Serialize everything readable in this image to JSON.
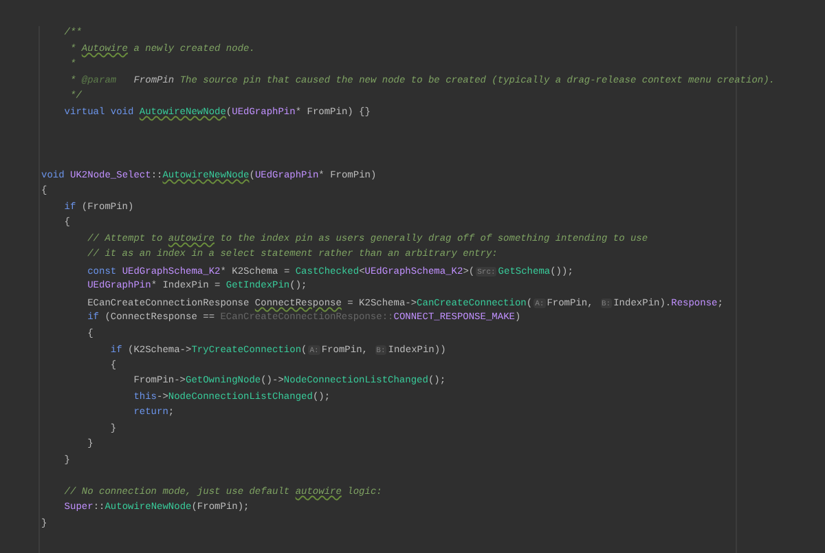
{
  "editor": {
    "lines": [
      {
        "kind": "code",
        "tokens": [
          {
            "text": "    /**",
            "kind": "comment"
          }
        ]
      },
      {
        "kind": "code",
        "tokens": [
          {
            "text": "     * ",
            "kind": "comment"
          },
          {
            "text": "Autowire",
            "kind": "comment",
            "wavy": true
          },
          {
            "text": " a newly created node.",
            "kind": "comment"
          }
        ]
      },
      {
        "kind": "code",
        "tokens": [
          {
            "text": "     *",
            "kind": "comment"
          }
        ]
      },
      {
        "kind": "code",
        "tokens": [
          {
            "text": "     * ",
            "kind": "comment"
          },
          {
            "text": "@param",
            "kind": "doctag"
          },
          {
            "text": "   FromPin",
            "kind": "docparam"
          },
          {
            "text": " The source pin that caused the new node to be created (typically a drag-release context menu creation).",
            "kind": "comment"
          }
        ]
      },
      {
        "kind": "code",
        "tokens": [
          {
            "text": "     */",
            "kind": "comment"
          }
        ]
      },
      {
        "kind": "code",
        "tokens": [
          {
            "text": "    virtual void ",
            "kind": "keyword"
          },
          {
            "text": "AutowireNewNode",
            "kind": "func",
            "wavy": true
          },
          {
            "text": "(",
            "kind": "plain"
          },
          {
            "text": "UEdGraphPin",
            "kind": "type"
          },
          {
            "text": "* FromPin) {}",
            "kind": "plain"
          }
        ]
      },
      {
        "kind": "blank"
      },
      {
        "kind": "blank"
      },
      {
        "kind": "blank"
      },
      {
        "kind": "code",
        "tokens": [
          {
            "text": "void ",
            "kind": "keyword"
          },
          {
            "text": "UK2Node_Select",
            "kind": "type"
          },
          {
            "text": "::",
            "kind": "plain"
          },
          {
            "text": "AutowireNewNode",
            "kind": "func",
            "wavy": true
          },
          {
            "text": "(",
            "kind": "plain"
          },
          {
            "text": "UEdGraphPin",
            "kind": "type"
          },
          {
            "text": "* FromPin)",
            "kind": "plain"
          }
        ]
      },
      {
        "kind": "code",
        "tokens": [
          {
            "text": "{",
            "kind": "plain"
          }
        ]
      },
      {
        "kind": "code",
        "tokens": [
          {
            "text": "    if",
            "kind": "keyword"
          },
          {
            "text": " (FromPin)",
            "kind": "plain"
          }
        ]
      },
      {
        "kind": "code",
        "tokens": [
          {
            "text": "    {",
            "kind": "plain"
          }
        ]
      },
      {
        "kind": "code",
        "tokens": [
          {
            "text": "        // Attempt to ",
            "kind": "comment"
          },
          {
            "text": "autowire",
            "kind": "comment",
            "wavy": true
          },
          {
            "text": " to the index pin as users generally drag off of something intending to use",
            "kind": "comment"
          }
        ]
      },
      {
        "kind": "code",
        "tokens": [
          {
            "text": "        // it as an index in a select statement rather than an arbitrary entry:",
            "kind": "comment"
          }
        ]
      },
      {
        "kind": "code",
        "tokens": [
          {
            "text": "        const ",
            "kind": "keyword"
          },
          {
            "text": "UEdGraphSchema_K2",
            "kind": "type"
          },
          {
            "text": "* K2Schema = ",
            "kind": "plain"
          },
          {
            "text": "CastChecked",
            "kind": "func"
          },
          {
            "text": "<",
            "kind": "plain"
          },
          {
            "text": "UEdGraphSchema_K2",
            "kind": "type"
          },
          {
            "text": ">(",
            "kind": "plain"
          },
          {
            "text": "Src:",
            "kind": "hint"
          },
          {
            "text": "GetSchema",
            "kind": "func"
          },
          {
            "text": "());",
            "kind": "plain"
          }
        ]
      },
      {
        "kind": "code",
        "tokens": [
          {
            "text": "        UEdGraphPin",
            "kind": "type"
          },
          {
            "text": "* IndexPin = ",
            "kind": "plain"
          },
          {
            "text": "GetIndexPin",
            "kind": "func"
          },
          {
            "text": "();",
            "kind": "plain"
          }
        ]
      },
      {
        "kind": "code",
        "tokens": [
          {
            "text": "        ECanCreateConnectionResponse ",
            "kind": "plain"
          },
          {
            "text": "ConnectResponse",
            "kind": "plain",
            "wavy": true
          },
          {
            "text": " = K2Schema->",
            "kind": "plain"
          },
          {
            "text": "CanCreateConnection",
            "kind": "func"
          },
          {
            "text": "(",
            "kind": "plain"
          },
          {
            "text": "A:",
            "kind": "hint"
          },
          {
            "text": "FromPin, ",
            "kind": "plain"
          },
          {
            "text": "B:",
            "kind": "hint"
          },
          {
            "text": "IndexPin).",
            "kind": "plain"
          },
          {
            "text": "Response",
            "kind": "field"
          },
          {
            "text": ";",
            "kind": "plain"
          }
        ]
      },
      {
        "kind": "code",
        "tokens": [
          {
            "text": "        if",
            "kind": "keyword"
          },
          {
            "text": " (ConnectResponse == ",
            "kind": "plain"
          },
          {
            "text": "ECanCreateConnectionResponse::",
            "kind": "faded"
          },
          {
            "text": "CONNECT_RESPONSE_MAKE",
            "kind": "field"
          },
          {
            "text": ")",
            "kind": "plain"
          }
        ]
      },
      {
        "kind": "code",
        "tokens": [
          {
            "text": "        {",
            "kind": "plain"
          }
        ]
      },
      {
        "kind": "code",
        "tokens": [
          {
            "text": "            if",
            "kind": "keyword"
          },
          {
            "text": " (K2Schema->",
            "kind": "plain"
          },
          {
            "text": "TryCreateConnection",
            "kind": "func"
          },
          {
            "text": "(",
            "kind": "plain"
          },
          {
            "text": "A:",
            "kind": "hint"
          },
          {
            "text": "FromPin, ",
            "kind": "plain"
          },
          {
            "text": "B:",
            "kind": "hint"
          },
          {
            "text": "IndexPin))",
            "kind": "plain"
          }
        ]
      },
      {
        "kind": "code",
        "tokens": [
          {
            "text": "            {",
            "kind": "plain"
          }
        ]
      },
      {
        "kind": "code",
        "tokens": [
          {
            "text": "                FromPin->",
            "kind": "plain"
          },
          {
            "text": "GetOwningNode",
            "kind": "func"
          },
          {
            "text": "()->",
            "kind": "plain"
          },
          {
            "text": "NodeConnectionListChanged",
            "kind": "func"
          },
          {
            "text": "();",
            "kind": "plain"
          }
        ]
      },
      {
        "kind": "code",
        "tokens": [
          {
            "text": "                this",
            "kind": "keyword"
          },
          {
            "text": "->",
            "kind": "plain"
          },
          {
            "text": "NodeConnectionListChanged",
            "kind": "func"
          },
          {
            "text": "();",
            "kind": "plain"
          }
        ]
      },
      {
        "kind": "code",
        "tokens": [
          {
            "text": "                return",
            "kind": "keyword"
          },
          {
            "text": ";",
            "kind": "plain"
          }
        ]
      },
      {
        "kind": "code",
        "tokens": [
          {
            "text": "            }",
            "kind": "plain"
          }
        ]
      },
      {
        "kind": "code",
        "tokens": [
          {
            "text": "        }",
            "kind": "plain"
          }
        ]
      },
      {
        "kind": "code",
        "tokens": [
          {
            "text": "    }",
            "kind": "plain"
          }
        ]
      },
      {
        "kind": "blank"
      },
      {
        "kind": "code",
        "tokens": [
          {
            "text": "    // No connection mode, just use default ",
            "kind": "comment"
          },
          {
            "text": "autowire",
            "kind": "comment",
            "wavy": true
          },
          {
            "text": " logic:",
            "kind": "comment"
          }
        ]
      },
      {
        "kind": "code",
        "tokens": [
          {
            "text": "    Super",
            "kind": "field"
          },
          {
            "text": "::",
            "kind": "plain"
          },
          {
            "text": "AutowireNewNode",
            "kind": "func"
          },
          {
            "text": "(FromPin);",
            "kind": "plain"
          }
        ]
      },
      {
        "kind": "code",
        "tokens": [
          {
            "text": "}",
            "kind": "plain"
          }
        ]
      }
    ]
  }
}
